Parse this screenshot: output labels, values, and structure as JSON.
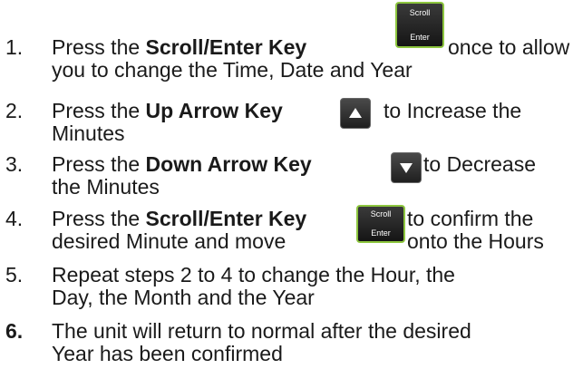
{
  "steps": [
    {
      "number": "1.",
      "line1_before": "Press the ",
      "line1_bold": "Scroll/Enter Key",
      "line1_after": "once to allow",
      "line2": "you to change the Time, Date and Year",
      "key": "scroll-enter"
    },
    {
      "number": "2.",
      "line1_before": "Press the ",
      "line1_bold": "Up Arrow Key",
      "line1_after": "to Increase the",
      "line2": "Minutes",
      "key": "up-arrow"
    },
    {
      "number": "3.",
      "line1_before": "Press the ",
      "line1_bold": "Down Arrow Key",
      "line1_after": "to Decrease",
      "line2": "the Minutes",
      "key": "down-arrow"
    },
    {
      "number": "4.",
      "line1_before": "Press the ",
      "line1_bold": "Scroll/Enter Key",
      "line1_after": "to confirm the",
      "line2_a": "desired Minute and move",
      "line2_b": "onto the Hours",
      "key": "scroll-enter"
    },
    {
      "number": "5.",
      "line1": "Repeat steps 2 to 4 to change the Hour, the",
      "line2": "Day, the Month and the Year"
    },
    {
      "number": "6.",
      "line1": "The unit will return to normal after the desired",
      "line2": "Year has been confirmed"
    }
  ],
  "scroll_key": {
    "top_label": "Scroll",
    "bottom_label": "Enter",
    "icon": "scroll-enter-key-icon",
    "border_color": "#8dc63f"
  },
  "arrow_keys": {
    "up_icon": "up-arrow-key-icon",
    "down_icon": "down-arrow-key-icon"
  }
}
